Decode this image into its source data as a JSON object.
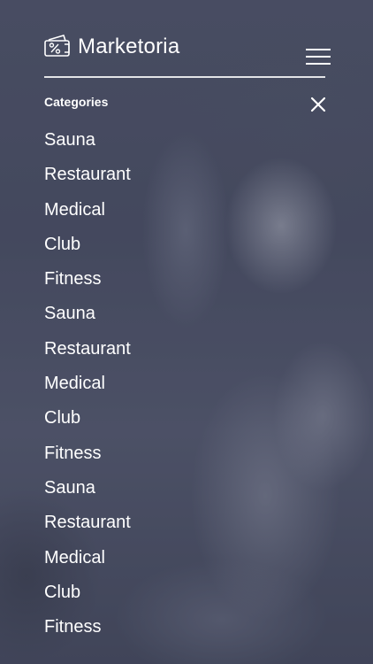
{
  "header": {
    "title": "Marketoria",
    "logo_icon": "coupon-percent-icon",
    "menu_icon": "hamburger-menu-icon"
  },
  "panel": {
    "title": "Categories",
    "close_icon": "close-icon"
  },
  "categories": [
    "Sauna",
    "Restaurant",
    "Medical",
    "Club",
    "Fitness",
    "Sauna",
    "Restaurant",
    "Medical",
    "Club",
    "Fitness",
    "Sauna",
    "Restaurant",
    "Medical",
    "Club",
    "Fitness"
  ],
  "colors": {
    "overlay": "#4a4e62",
    "text": "#ffffff"
  }
}
